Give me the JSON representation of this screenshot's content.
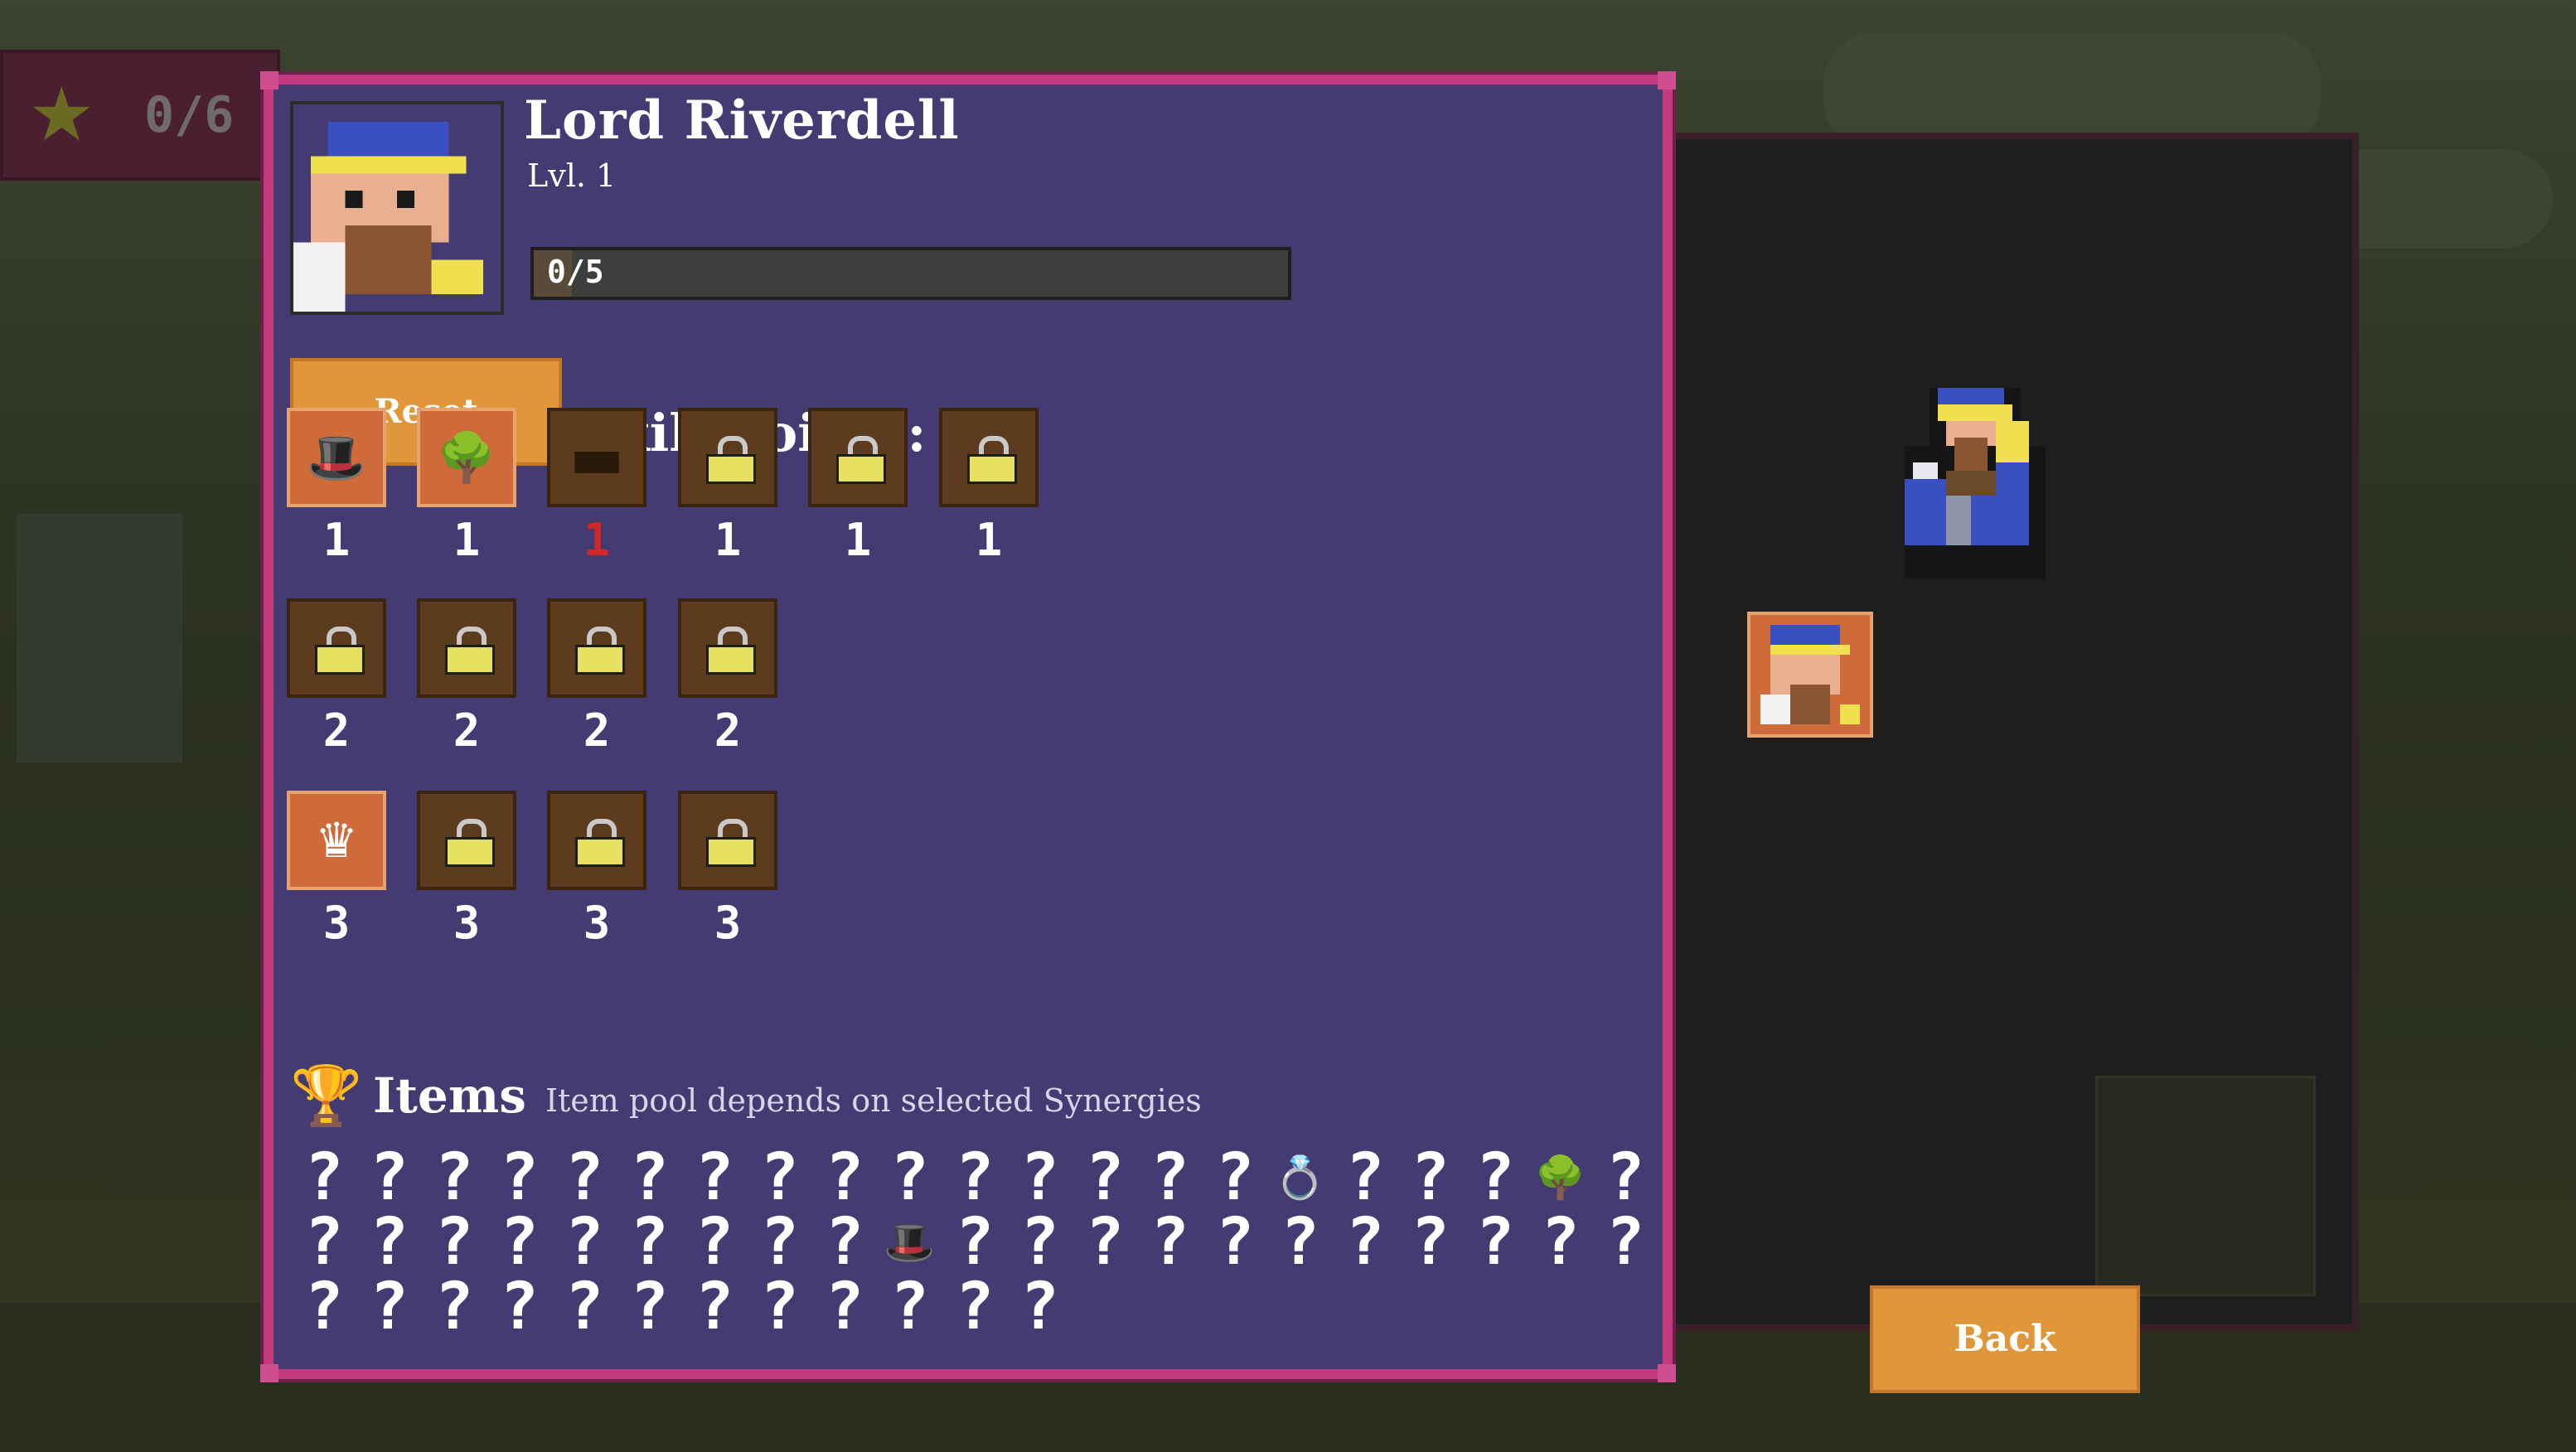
{
  "top_counter": {
    "value": "0/6",
    "icon": "star-icon"
  },
  "hero": {
    "name": "Lord Riverdell",
    "level": "Lvl. 1",
    "xp": "0/5",
    "xp_fraction": 0.0
  },
  "reset_label": "Reset",
  "skill_points": "Skill Points: 0/5",
  "skills": {
    "row1": [
      {
        "state": "unlocked",
        "icon": "hat-icon",
        "cost": "1",
        "cost_color": "white"
      },
      {
        "state": "unlocked",
        "icon": "tree-icon",
        "cost": "1",
        "cost_color": "white"
      },
      {
        "state": "available",
        "icon": "chest-icon",
        "cost": "1",
        "cost_color": "red"
      },
      {
        "state": "locked",
        "icon": "lock-icon",
        "cost": "1",
        "cost_color": "white"
      },
      {
        "state": "locked",
        "icon": "lock-icon",
        "cost": "1",
        "cost_color": "white"
      },
      {
        "state": "locked",
        "icon": "lock-icon",
        "cost": "1",
        "cost_color": "white"
      }
    ],
    "row2": [
      {
        "state": "locked",
        "icon": "lock-icon",
        "cost": "2",
        "cost_color": "white"
      },
      {
        "state": "locked",
        "icon": "lock-icon",
        "cost": "2",
        "cost_color": "white"
      },
      {
        "state": "locked",
        "icon": "lock-icon",
        "cost": "2",
        "cost_color": "white"
      },
      {
        "state": "locked",
        "icon": "lock-icon",
        "cost": "2",
        "cost_color": "white"
      }
    ],
    "row3": [
      {
        "state": "unlocked",
        "icon": "crown-icon",
        "cost": "3",
        "cost_color": "white"
      },
      {
        "state": "locked",
        "icon": "lock-icon",
        "cost": "3",
        "cost_color": "white"
      },
      {
        "state": "locked",
        "icon": "lock-icon",
        "cost": "3",
        "cost_color": "white"
      },
      {
        "state": "locked",
        "icon": "lock-icon",
        "cost": "3",
        "cost_color": "white"
      }
    ]
  },
  "items": {
    "title": "Items",
    "subtitle": "Item pool depends on selected Synergies",
    "unknown_glyph": "?",
    "grid": [
      "?",
      "?",
      "?",
      "?",
      "?",
      "?",
      "?",
      "?",
      "?",
      "?",
      "?",
      "?",
      "?",
      "?",
      "?",
      "ring",
      "?",
      "?",
      "?",
      "tree",
      "?",
      "?",
      "?",
      "?",
      "?",
      "?",
      "?",
      "?",
      "?",
      "?",
      "hat",
      "?",
      "?",
      "?",
      "?",
      "?",
      "?",
      "?",
      "?",
      "?",
      "?",
      "?",
      "?",
      "?",
      "?",
      "?",
      "?",
      "?",
      "?",
      "?",
      "?",
      "?",
      "?",
      "?"
    ]
  },
  "back_label": "Back",
  "colors": {
    "panel": "#443b72",
    "panel_border": "#c23a7e",
    "button": "#e0973a",
    "slot_unlocked": "#cf6a3a",
    "slot_locked": "#5c3b1e",
    "red_cost": "#d02828"
  }
}
